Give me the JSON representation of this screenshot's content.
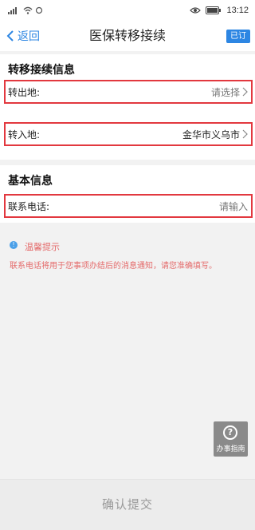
{
  "status_bar": {
    "signal_icon": "signal-icon",
    "wifi_icon": "wifi-icon",
    "eye_icon": "eye-icon",
    "battery_icon": "battery-icon",
    "time": "13:12"
  },
  "nav": {
    "back_label": "返回",
    "title": "医保转移接续",
    "subscribe_label": "已订"
  },
  "transfer_section": {
    "title": "转移接续信息",
    "out_label": "转出地:",
    "out_placeholder": "请选择",
    "in_label": "转入地:",
    "in_value": "金华市义乌市"
  },
  "basic_section": {
    "title": "基本信息",
    "phone_label": "联系电话:",
    "phone_placeholder": "请输入"
  },
  "tip": {
    "title": "温馨提示",
    "text": "联系电话将用于您事项办结后的消息通知，请您准确填写。"
  },
  "guide": {
    "label": "办事指南"
  },
  "submit_label": "确认提交",
  "colors": {
    "accent": "#2d86e3",
    "highlight_border": "#e2383f",
    "tip_text": "#e46a6a"
  }
}
